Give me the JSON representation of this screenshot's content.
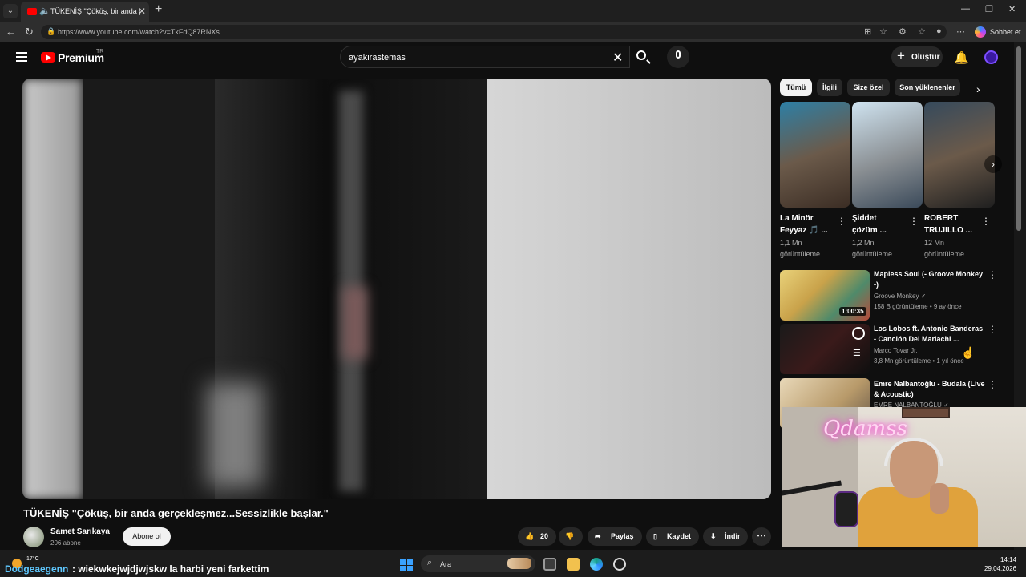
{
  "browser": {
    "tab_title": "TÜKENİŞ \"Çöküş, bir anda gerçekleşmez...Sessizlikle başlar.\"",
    "url": "https://www.youtube.com/watch?v=TkFdQ87RNXs",
    "copilot_label": "Sohbet et"
  },
  "header": {
    "brand": "Premium",
    "region": "TR",
    "search_value": "ayakirastemas",
    "create_label": "Oluştur"
  },
  "video": {
    "title": "TÜKENİŞ \"Çöküş, bir anda gerçekleşmez...Sessizlikle başlar.\"",
    "channel": "Samet Sarıkaya",
    "subscribers": "206 abone",
    "subscribe_label": "Abone ol",
    "likes": "20",
    "share_label": "Paylaş",
    "save_label": "Kaydet",
    "download_label": "İndir"
  },
  "chips": [
    "Tümü",
    "İlgili",
    "Size özel",
    "Son yüklenenler"
  ],
  "shorts": [
    {
      "title_line1": "La Minör",
      "title_line2": "Feyyaz 🎵 ...",
      "views_line1": "1,1 Mn",
      "views_line2": "görüntüleme"
    },
    {
      "title_line1": "Şiddet",
      "title_line2": "çözüm ...",
      "views_line1": "1,2 Mn",
      "views_line2": "görüntüleme"
    },
    {
      "title_line1": "ROBERT",
      "title_line2": "TRUJILLO ...",
      "views_line1": "12 Mn",
      "views_line2": "görüntüleme"
    }
  ],
  "recommendations": [
    {
      "title_line1": "Mapless Soul (- Groove Monkey",
      "title_line2": "-)",
      "channel": "Groove Monkey ✓",
      "meta": "158 B görüntüleme • 9 ay önce",
      "duration": "1:00:35"
    },
    {
      "title_line1": "Los Lobos ft. Antonio Banderas",
      "title_line2": "- Canción Del Mariachi ...",
      "channel": "Marco Tovar Jr.",
      "meta": "3,8 Mn görüntüleme • 1 yıl önce"
    },
    {
      "title_line1": "Emre Nalbantoğlu - Budala (Live",
      "title_line2": "& Acoustic)",
      "channel": "EMRE NALBANTOĞLU ✓"
    }
  ],
  "webcam": {
    "neon_text": "Qdamss"
  },
  "taskbar": {
    "weather_temp": "17°C",
    "chat_user": "Dodgeaegenn",
    "chat_message": ": wiekwkejwjdjwjskw la harbi yeni farkettim",
    "search_label": "Ara",
    "time": "14:14",
    "date": "29.04.2026"
  }
}
